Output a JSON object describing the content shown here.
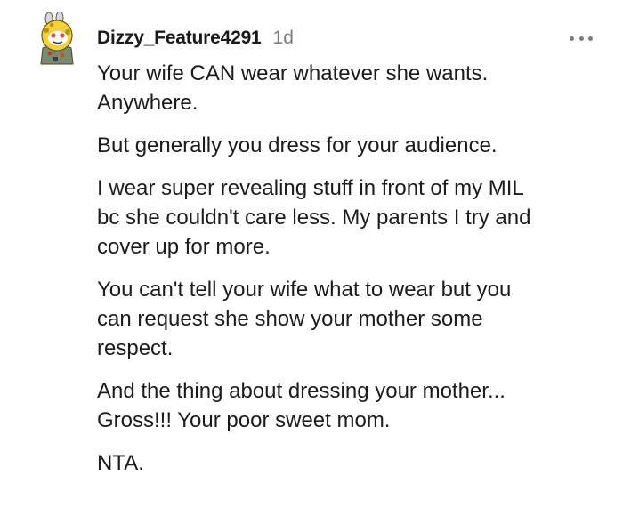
{
  "comment": {
    "username": "Dizzy_Feature4291",
    "age": "1d",
    "more_icon": "ellipsis-icon",
    "avatar_icon": "snoo-avatar-icon",
    "paragraphs": [
      "Your wife CAN wear whatever she wants.\nAnywhere.",
      "But generally you dress for your audience.",
      "I wear super revealing stuff in front of my MIL\nbc she couldn't care less. My parents I try and\ncover up for more.",
      "You can't tell your wife what to wear but you\ncan request she show your mother some\nrespect.",
      "And the thing about dressing your mother...\nGross!!! Your poor sweet mom.",
      "NTA."
    ]
  }
}
